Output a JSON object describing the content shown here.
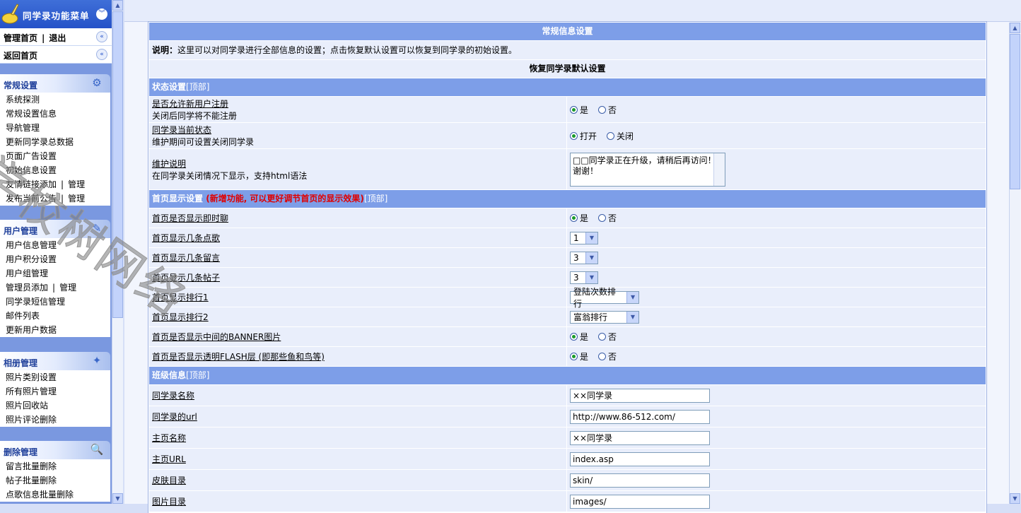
{
  "sidebar": {
    "title": "同学录功能菜单",
    "links": [
      {
        "a": "管理首页",
        "sep": "|",
        "b": "退出"
      },
      {
        "a": "返回首页"
      }
    ],
    "groups": [
      {
        "title": "常规设置",
        "icon": "settings-icon",
        "items": [
          "系统探测",
          "常规设置信息",
          "导航管理",
          "更新同学录总数据",
          "页面广告设置",
          "初始信息设置"
        ],
        "pair_items": [
          {
            "a": "友情链接添加",
            "b": "管理"
          },
          {
            "a": "发布当前公告",
            "b": "管理"
          }
        ]
      },
      {
        "title": "用户管理",
        "icon": "user-edit-icon",
        "items": [
          "用户信息管理",
          "用户积分设置",
          "用户组管理"
        ],
        "pair_items": [
          {
            "a": "管理员添加",
            "b": "管理"
          }
        ],
        "items2": [
          "同学录短信管理",
          "邮件列表",
          "更新用户数据"
        ]
      },
      {
        "title": "相册管理",
        "icon": "album-icon",
        "items": [
          "照片类别设置",
          "所有照片管理",
          "照片回收站",
          "照片评论删除"
        ]
      },
      {
        "title": "删除管理",
        "icon": "magnifier-icon",
        "items": [
          "留言批量删除",
          "帖子批量删除",
          "点歌信息批量删除"
        ]
      }
    ]
  },
  "watermark": "学校树网络",
  "main": {
    "header": "常规信息设置",
    "note_label": "说明：",
    "note_text": "这里可以对同学录进行全部信息的设置；点击恢复默认设置可以恢复到同学录的初始设置。",
    "restore_label": "恢复同学录默认设置",
    "top_link": "[顶部]",
    "sections": {
      "status": {
        "title": "状态设置",
        "rows": [
          {
            "label": "是否允许新用户注册",
            "desc": "关闭后同学将不能注册",
            "options": [
              "是",
              "否"
            ],
            "selected": 0
          },
          {
            "label": "同学录当前状态",
            "desc": "维护期间可设置关闭同学录",
            "options": [
              "打开",
              "关闭"
            ],
            "selected": 0
          },
          {
            "label": "维护说明",
            "desc": "在同学录关闭情况下显示，支持html语法",
            "textarea": "□□同学录正在升级，请稍后再访问！谢谢！"
          }
        ]
      },
      "home": {
        "title": "首页显示设置",
        "highlight": "(新增功能, 可以更好调节首页的显示效果)",
        "rows": [
          {
            "label": "首页是否显示即时聊",
            "options": [
              "是",
              "否"
            ],
            "selected": 0
          },
          {
            "label": "首页显示几条点歌",
            "select": "1"
          },
          {
            "label": "首页显示几条留言",
            "select": "3"
          },
          {
            "label": "首页显示几条帖子",
            "select": "3"
          },
          {
            "label": "首页显示排行1",
            "select": "登陆次数排行"
          },
          {
            "label": "首页显示排行2",
            "select": "富翁排行"
          },
          {
            "label": "首页是否显示中间的BANNER图片",
            "options": [
              "是",
              "否"
            ],
            "selected": 0
          },
          {
            "label": "首页是否显示透明FLASH层 (即那些鱼和鸟等)",
            "options": [
              "是",
              "否"
            ],
            "selected": 0
          }
        ]
      },
      "class": {
        "title": "班级信息",
        "rows": [
          {
            "label": "同学录名称",
            "value": "××同学录"
          },
          {
            "label": "同学录的url",
            "value": "http://www.86-512.com/"
          },
          {
            "label": "主页名称",
            "value": "××同学录"
          },
          {
            "label": "主页URL",
            "value": "index.asp"
          },
          {
            "label": "皮肤目录",
            "value": "skin/"
          },
          {
            "label": "图片目录",
            "value": "images/"
          }
        ]
      }
    }
  }
}
